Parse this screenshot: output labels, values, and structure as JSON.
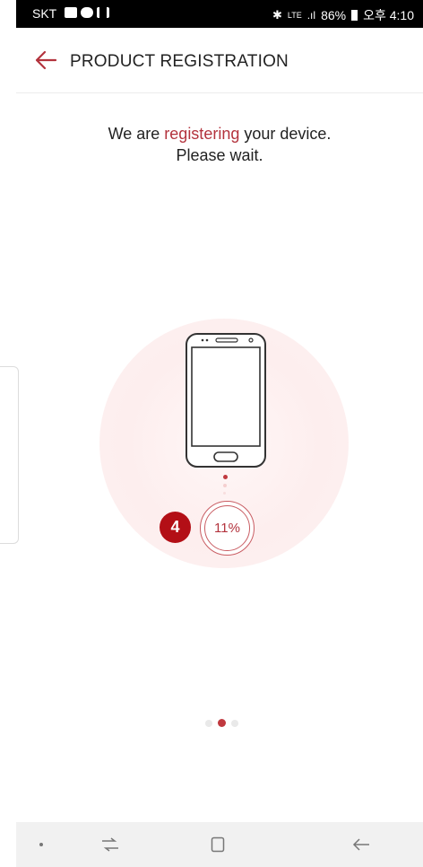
{
  "status_bar": {
    "carrier": "SKT",
    "right_text": "86%",
    "time": "오후 4:10",
    "icons": [
      "gallery-icon",
      "message-icon",
      "signal-toggle-icon",
      "bluetooth-icon",
      "lte-icon",
      "signal-bars-icon",
      "battery-icon"
    ]
  },
  "header": {
    "title": "PRODUCT REGISTRATION",
    "back_icon": "arrow-left-icon"
  },
  "message": {
    "line1_prefix": "We are ",
    "line1_accent": "registering",
    "line1_suffix": " your device.",
    "line2": "Please wait."
  },
  "progress": {
    "label": "11%",
    "value": 0.11
  },
  "step_badge": "4",
  "pager": {
    "count": 3,
    "active_index": 1
  },
  "nav_bar": {
    "items": [
      "dot-icon",
      "recents-icon",
      "home-icon",
      "back-icon"
    ]
  },
  "colors": {
    "accent": "#b3333d",
    "badge": "#b30f16",
    "glow": "#fdeeee"
  }
}
